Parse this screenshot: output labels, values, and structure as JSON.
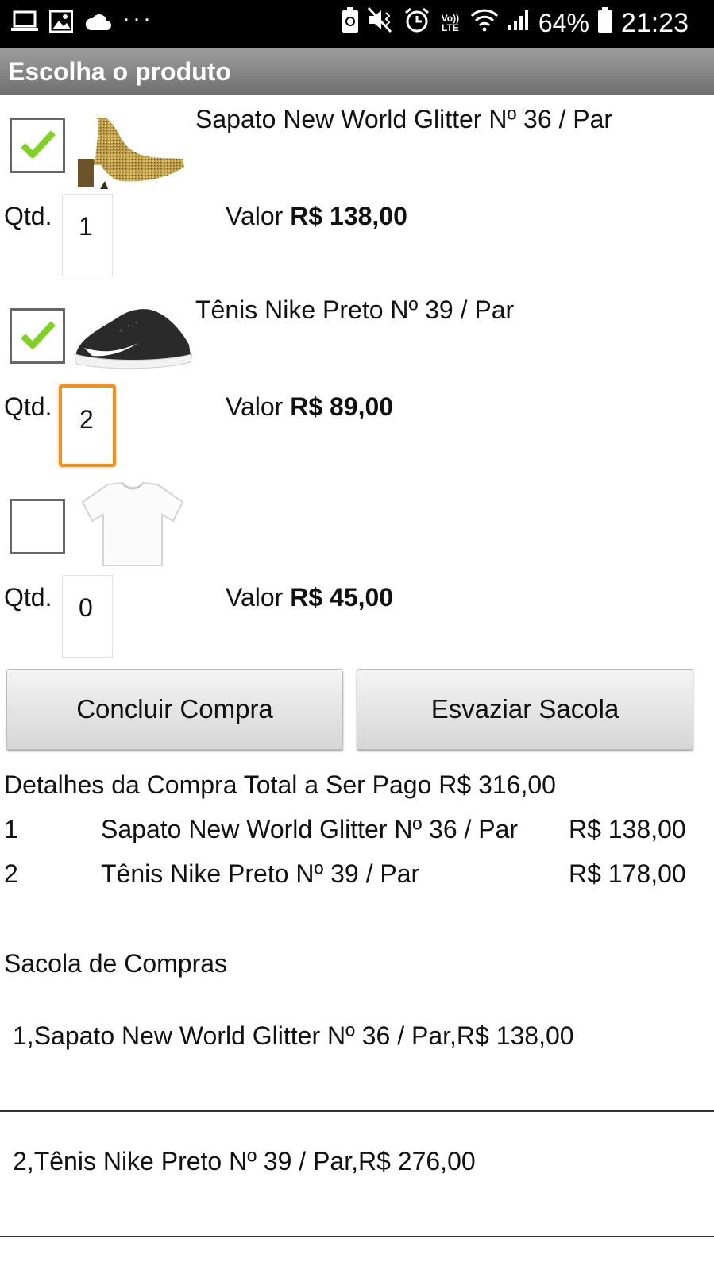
{
  "status_bar": {
    "volte_label": "Vo)) LTE",
    "battery_percent": "64%",
    "time": "21:23",
    "icons": [
      "laptop-icon",
      "image-icon",
      "cloud-icon",
      "more-dots-icon",
      "battery-saver-icon",
      "mute-vibrate-icon",
      "alarm-icon",
      "volte-icon",
      "wifi-icon",
      "signal-icon",
      "battery-icon"
    ],
    "more": "···"
  },
  "header": {
    "title": "Escolha o produto"
  },
  "qtd_label": "Qtd.",
  "valor_label": "Valor",
  "products": [
    {
      "name": "Sapato New World Glitter Nº 36 / Par",
      "checked": true,
      "qty": "1",
      "price": "R$ 138,00",
      "image": "gold-glitter-heel"
    },
    {
      "name": "Tênis Nike Preto Nº 39 / Par",
      "checked": true,
      "qty": "2",
      "price": "R$ 89,00",
      "image": "black-nike-sneaker"
    },
    {
      "name": "",
      "checked": false,
      "qty": "0",
      "price": "R$ 45,00",
      "image": "white-tshirt"
    }
  ],
  "buttons": {
    "conclude": "Concluir Compra",
    "empty": "Esvaziar Sacola"
  },
  "details": {
    "header": "Detalhes da Compra Total a Ser Pago R$ 316,00",
    "rows": [
      {
        "index": "1",
        "name": "Sapato New World Glitter Nº 36 / Par",
        "value": "R$ 138,00"
      },
      {
        "index": "2",
        "name": "Tênis Nike Preto Nº 39 / Par",
        "value": "R$ 178,00"
      }
    ]
  },
  "bag": {
    "title": "Sacola de Compras",
    "items": [
      "1,Sapato New World Glitter Nº 36 / Par,R$ 138,00",
      "2,Tênis Nike Preto Nº 39 / Par,R$ 276,00"
    ]
  },
  "colors": {
    "check": "#7ed321",
    "focus_border": "#f0901e",
    "title_bar": "#8a8a8a"
  }
}
